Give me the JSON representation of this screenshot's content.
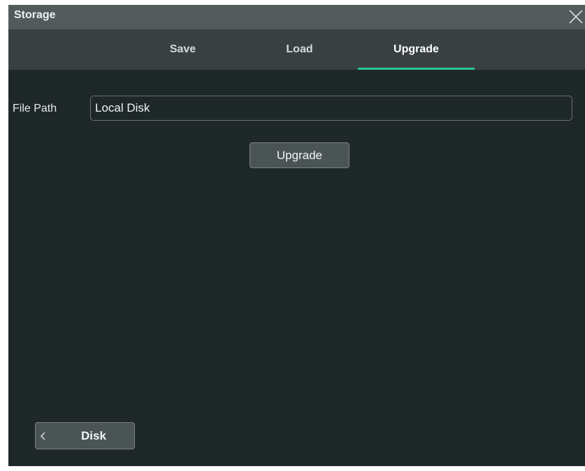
{
  "window": {
    "title": "Storage",
    "close_icon": "close-icon"
  },
  "tabs": [
    {
      "label": "Save",
      "active": false
    },
    {
      "label": "Load",
      "active": false
    },
    {
      "label": "Upgrade",
      "active": true
    }
  ],
  "colors": {
    "accent": "#2bc79a",
    "background": "#1f2829",
    "titlebar": "#525a5b",
    "tabbar": "#384042"
  },
  "form": {
    "file_path_label": "File Path",
    "file_path_value": "Local Disk"
  },
  "actions": {
    "upgrade_label": "Upgrade",
    "disk_label": "Disk",
    "disk_icon": "chevron-left-icon"
  }
}
